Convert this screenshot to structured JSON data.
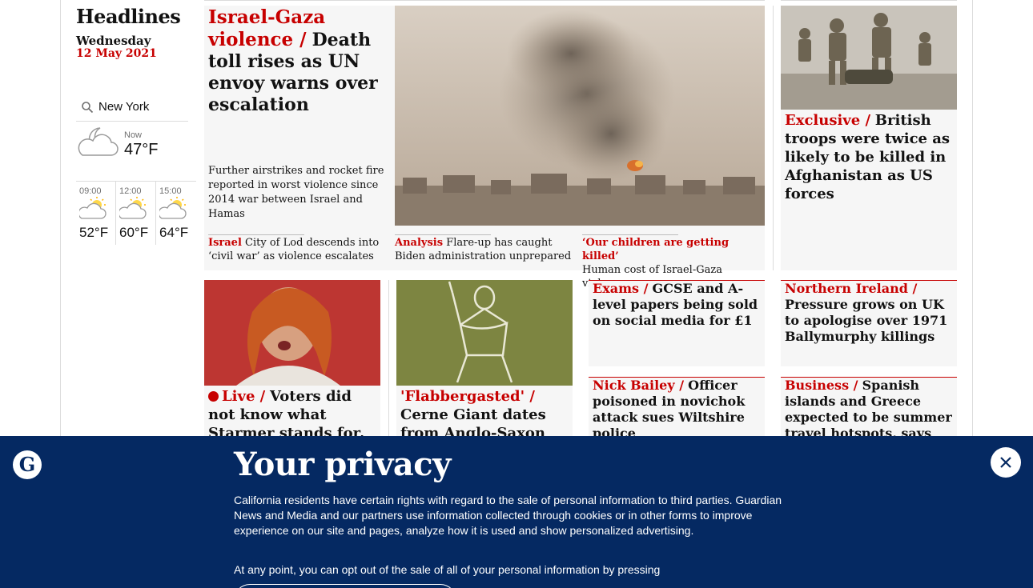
{
  "sidebar": {
    "title": "Headlines",
    "date_day": "Wednesday",
    "date_full": "12 May 2021",
    "weather": {
      "location": "New York",
      "now_label": "Now",
      "now_temp": "47°F",
      "forecast": [
        {
          "time": "09:00",
          "temp": "52°F"
        },
        {
          "time": "12:00",
          "temp": "60°F"
        },
        {
          "time": "15:00",
          "temp": "64°F"
        }
      ]
    }
  },
  "main_story": {
    "kicker": "Israel-Gaza violence /",
    "headline": "Death toll rises as UN envoy warns over escalation",
    "standfirst": "Further airstrikes and rocket fire reported in worst violence since 2014 war between Israel and Hamas",
    "sublinks": [
      {
        "kicker": "Israel",
        "text": "City of Lod descends into ‘civil war’ as violence escalates"
      },
      {
        "kicker": "Analysis",
        "text": "Flare-up has caught Biden administration unprepared"
      },
      {
        "kicker": "‘Our children are getting killed’",
        "text": "Human cost of Israel-Gaza violence"
      }
    ]
  },
  "right_story": {
    "kicker": "Exclusive /",
    "headline": "British troops were twice as likely to be killed in Afghanistan as US forces"
  },
  "row2": {
    "live": {
      "kicker": "Live /",
      "headline": "Voters did not know what Starmer stands for, says deputy"
    },
    "giant": {
      "kicker": "'Flabbergasted' /",
      "headline": "Cerne Giant dates from Anglo-Saxon times"
    },
    "exams": {
      "kicker": "Exams /",
      "headline": "GCSE and A-level papers being sold on social media for £1"
    },
    "nick": {
      "kicker": "Nick Bailey /",
      "headline": "Officer poisoned in novichok attack sues Wiltshire police"
    },
    "ni": {
      "kicker": "Northern Ireland /",
      "headline": "Pressure grows on UK to apologise over 1971 Ballymurphy killings"
    },
    "business": {
      "kicker": "Business /",
      "headline": "Spanish islands and Greece expected to be summer travel hotspots, says Tui"
    }
  },
  "privacy": {
    "title": "Your privacy",
    "body": "California residents have certain rights with regard to the sale of personal information to third parties. Guardian News and Media and our partners use information collected through cookies or in other forms to improve experience on our site and pages, analyze how it is used and show personalized advertising.",
    "body2": "At any point, you can opt out of the sale of all of your personal information by pressing",
    "logo_letter": "G"
  },
  "colors": {
    "accent": "#c70000",
    "banner": "#052962",
    "card": "#f6f6f6"
  }
}
